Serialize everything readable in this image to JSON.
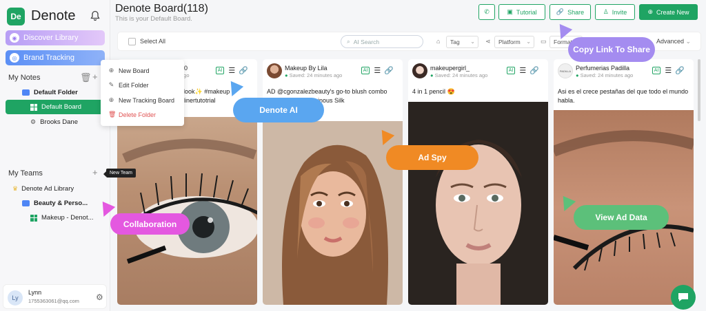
{
  "app": {
    "name": "Denote",
    "logo_text": "De"
  },
  "sidebar": {
    "discover_label": "Discover Library",
    "brand_tracking_label": "Brand Tracking",
    "my_notes_label": "My Notes",
    "default_folder": "Default Folder",
    "default_board": "Default Board",
    "brooks_dane": "Brooks Dane",
    "my_teams_label": "My Teams",
    "team_library": "Denote Ad Library",
    "team_folder": "Beauty & Perso...",
    "team_board": "Makeup - Denot..."
  },
  "context_menu": {
    "new_board": "New Board",
    "edit_folder": "Edit Folder",
    "new_tracking_board": "New Tracking Board",
    "delete_folder": "Delete Folder"
  },
  "tooltip": "New Team",
  "user": {
    "initials": "Ly",
    "name": "Lynn",
    "email": "1755363061@qq.com"
  },
  "header": {
    "title": "Denote Board(118)",
    "subtitle": "This is your Default Board.",
    "tutorial": "Tutorial",
    "share": "Share",
    "invite": "Invite",
    "create_new": "Create New"
  },
  "filters": {
    "select_all": "Select All",
    "search_placeholder": "AI Search",
    "tag": "Tag",
    "platform": "Platform",
    "format": "Format",
    "advanced": "Advanced"
  },
  "cards": [
    {
      "name": "00",
      "saved": "ago",
      "ai": "AI",
      "text_line1": "look✨ #makeup",
      "text_line2": "linertutotrial"
    },
    {
      "name": "Makeup By Lila",
      "saved_icon": "●",
      "saved": "Saved: 24 minutes ago",
      "ai": "AI",
      "text_line1": "AD @cgonzalezbeauty's go-to blush combo",
      "text_line2": "...manibeauty Luminous Silk"
    },
    {
      "name": "makeupergirl_",
      "saved_icon": "●",
      "saved": "Saved: 24 minutes ago",
      "ai": "AI",
      "text_line1": "4 in 1 pencil 😍",
      "text_line2": ""
    },
    {
      "name": "Perfumerias Padilla",
      "saved_icon": "●",
      "saved": "Saved: 24 minutes ago",
      "ai": "AI",
      "text_line1": "Asi es el crece pestañas del que todo el mundo",
      "text_line2": "habla.",
      "brand_text": "PADILLA"
    }
  ],
  "badges": {
    "denote_ai": "Denote AI",
    "ad_spy": "Ad Spy",
    "collaboration": "Collaboration",
    "view_ad_data": "View Ad Data",
    "copy_link": "Copy Link To Share"
  },
  "colors": {
    "accent": "#1fa463",
    "denote_ai": "#5aa6f0",
    "ad_spy": "#f08a24",
    "collaboration": "#e458e0",
    "view_ad_data": "#5cc07a",
    "copy_link": "#a48cf0"
  }
}
